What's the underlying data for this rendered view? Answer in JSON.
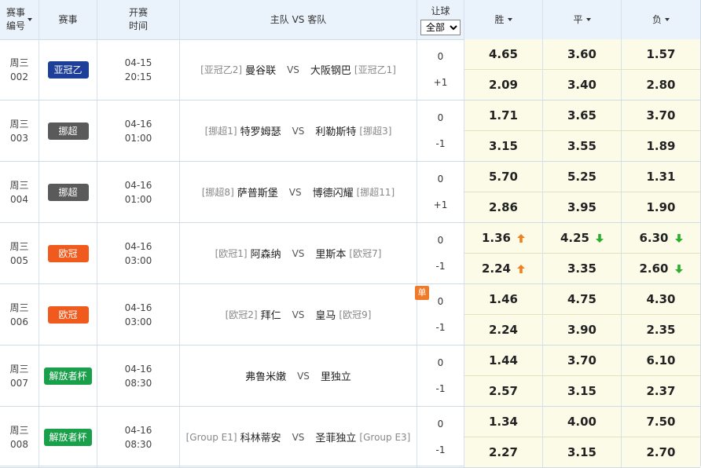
{
  "header": {
    "match_no": [
      "赛事",
      "编号"
    ],
    "league": "赛事",
    "kickoff": [
      "开赛",
      "时间"
    ],
    "teams": "主队 VS 客队",
    "handicap": "让球",
    "handicap_select": "全部",
    "win": "胜",
    "draw": "平",
    "lose": "负"
  },
  "colors": {
    "badge_acl2": "#1d3f9a",
    "badge_norway": "#5a5a5a",
    "badge_ucl": "#f15a1d",
    "badge_cup": "#1aa04b",
    "arrow_up": "#f0801e",
    "arrow_down": "#2bae2b",
    "odds_bg": "#fcfbe8",
    "header_bg": "#eaf2fb"
  },
  "rows": [
    {
      "day": "周三",
      "no": "002",
      "league": "亚冠乙",
      "badge": "badge_acl2",
      "date": "04-15",
      "time": "20:15",
      "home_rank": "[亚冠乙2]",
      "home": "曼谷联",
      "vs": "VS",
      "away": "大阪钢巴",
      "away_rank": "[亚冠乙1]",
      "hcap_top": "0",
      "hcap_bot": "+1",
      "odds_top": [
        "4.65",
        "3.60",
        "1.57"
      ],
      "odds_bot": [
        "2.09",
        "3.40",
        "2.80"
      ],
      "arrows_top": [
        "",
        "",
        ""
      ],
      "arrows_bot": [
        "",
        "",
        ""
      ]
    },
    {
      "day": "周三",
      "no": "003",
      "league": "挪超",
      "badge": "badge_norway",
      "date": "04-16",
      "time": "01:00",
      "home_rank": "[挪超1]",
      "home": "特罗姆瑟",
      "vs": "VS",
      "away": "利勒斯特",
      "away_rank": "[挪超3]",
      "hcap_top": "0",
      "hcap_bot": "-1",
      "odds_top": [
        "1.71",
        "3.65",
        "3.70"
      ],
      "odds_bot": [
        "3.15",
        "3.55",
        "1.89"
      ],
      "arrows_top": [
        "",
        "",
        ""
      ],
      "arrows_bot": [
        "",
        "",
        ""
      ]
    },
    {
      "day": "周三",
      "no": "004",
      "league": "挪超",
      "badge": "badge_norway",
      "date": "04-16",
      "time": "01:00",
      "home_rank": "[挪超8]",
      "home": "萨普斯堡",
      "vs": "VS",
      "away": "博德闪耀",
      "away_rank": "[挪超11]",
      "hcap_top": "0",
      "hcap_bot": "+1",
      "odds_top": [
        "5.70",
        "5.25",
        "1.31"
      ],
      "odds_bot": [
        "2.86",
        "3.95",
        "1.90"
      ],
      "arrows_top": [
        "",
        "",
        ""
      ],
      "arrows_bot": [
        "",
        "",
        ""
      ]
    },
    {
      "day": "周三",
      "no": "005",
      "league": "欧冠",
      "badge": "badge_ucl",
      "date": "04-16",
      "time": "03:00",
      "home_rank": "[欧冠1]",
      "home": "阿森纳",
      "vs": "VS",
      "away": "里斯本",
      "away_rank": "[欧冠7]",
      "hcap_top": "0",
      "hcap_bot": "-1",
      "odds_top": [
        "1.36",
        "4.25",
        "6.30"
      ],
      "odds_bot": [
        "2.24",
        "3.35",
        "2.60"
      ],
      "arrows_top": [
        "up",
        "down",
        "down"
      ],
      "arrows_bot": [
        "up",
        "",
        "down"
      ]
    },
    {
      "day": "周三",
      "no": "006",
      "league": "欧冠",
      "badge": "badge_ucl",
      "date": "04-16",
      "time": "03:00",
      "home_rank": "[欧冠2]",
      "home": "拜仁",
      "vs": "VS",
      "away": "皇马",
      "away_rank": "[欧冠9]",
      "hcap_top": "0",
      "hcap_bot": "-1",
      "single": "单",
      "odds_top": [
        "1.46",
        "4.75",
        "4.30"
      ],
      "odds_bot": [
        "2.24",
        "3.90",
        "2.35"
      ],
      "arrows_top": [
        "",
        "",
        ""
      ],
      "arrows_bot": [
        "",
        "",
        ""
      ]
    },
    {
      "day": "周三",
      "no": "007",
      "league": "解放者杯",
      "badge": "badge_cup",
      "date": "04-16",
      "time": "08:30",
      "home_rank": "",
      "home": "弗鲁米嫩",
      "vs": "VS",
      "away": "里独立",
      "away_rank": "",
      "hcap_top": "0",
      "hcap_bot": "-1",
      "odds_top": [
        "1.44",
        "3.70",
        "6.10"
      ],
      "odds_bot": [
        "2.57",
        "3.15",
        "2.37"
      ],
      "arrows_top": [
        "",
        "",
        ""
      ],
      "arrows_bot": [
        "",
        "",
        ""
      ]
    },
    {
      "day": "周三",
      "no": "008",
      "league": "解放者杯",
      "badge": "badge_cup",
      "date": "04-16",
      "time": "08:30",
      "home_rank": "[Group E1]",
      "home": "科林蒂安",
      "vs": "VS",
      "away": "圣菲独立",
      "away_rank": "[Group E3]",
      "hcap_top": "0",
      "hcap_bot": "-1",
      "odds_top": [
        "1.34",
        "4.00",
        "7.50"
      ],
      "odds_bot": [
        "2.27",
        "3.15",
        "2.70"
      ],
      "arrows_top": [
        "",
        "",
        ""
      ],
      "arrows_bot": [
        "",
        "",
        ""
      ]
    }
  ]
}
